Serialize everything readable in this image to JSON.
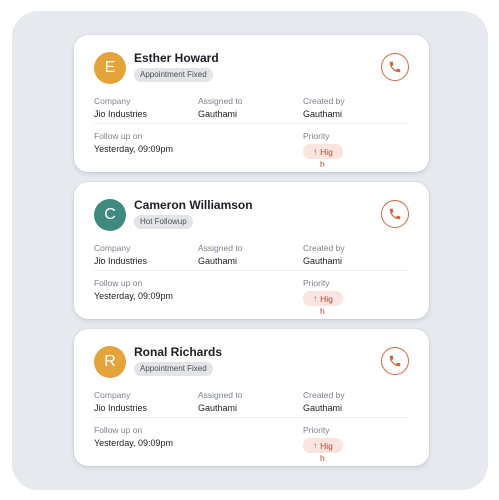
{
  "labels": {
    "company": "Company",
    "assigned_to": "Assigned to",
    "created_by": "Created by",
    "follow_up_on": "Follow up on",
    "priority": "Priority"
  },
  "colors": {
    "panel_background": "#e6e9ee",
    "call_accent": "#d7673e",
    "priority_background": "#fbe4e0",
    "priority_text": "#b84534"
  },
  "call_icon": "phone-icon",
  "priority_icon": "arrow-up-icon",
  "leads": [
    {
      "initial": "E",
      "avatar_color": "#e4a33b",
      "name": "Esther Howard",
      "status": "Appointment Fixed",
      "company": "Jio Industries",
      "assigned_to": "Gauthami",
      "created_by": "Gauthami",
      "follow_up_on": "Yesterday, 09:09pm",
      "priority_visible": "Hig",
      "priority_overflow": "h"
    },
    {
      "initial": "C",
      "avatar_color": "#3f8a7e",
      "name": "Cameron Williamson",
      "status": "Hot Followup",
      "company": "Jio Industries",
      "assigned_to": "Gauthami",
      "created_by": "Gauthami",
      "follow_up_on": "Yesterday, 09:09pm",
      "priority_visible": "Hig",
      "priority_overflow": "h"
    },
    {
      "initial": "R",
      "avatar_color": "#e4a33b",
      "name": "Ronal Richards",
      "status": "Appointment Fixed",
      "company": "Jio Industries",
      "assigned_to": "Gauthami",
      "created_by": "Gauthami",
      "follow_up_on": "Yesterday, 09:09pm",
      "priority_visible": "Hig",
      "priority_overflow": "h"
    }
  ]
}
